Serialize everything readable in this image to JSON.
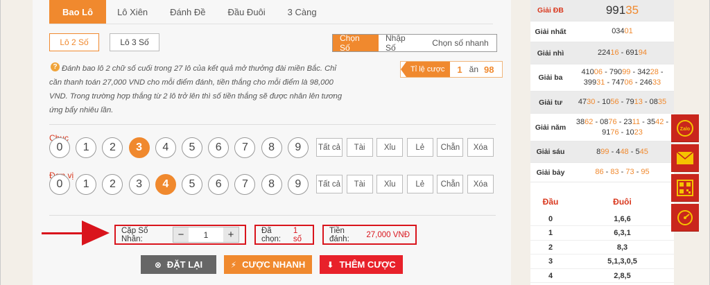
{
  "tabs": [
    "Bao Lô",
    "Lô Xiên",
    "Đánh Đề",
    "Đầu Đuôi",
    "3 Càng"
  ],
  "subtype": [
    "Lô 2 Số",
    "Lô 3 Số"
  ],
  "mode": [
    "Chọn Số",
    "Nhập Số",
    "Chọn số nhanh"
  ],
  "info": "Đánh bao lô 2 chữ số cuối trong 27 lô của kết quả mở thưởng đài miền Bắc. Chỉ cần thanh toán 27,000 VND cho mỗi điểm đánh, tiền thắng cho mỗi điểm là 98,000 VND. Trong trường hợp thắng từ 2 lô trở lên thì số tiền thắng sẽ được nhân lên tương ứng bẩy nhiêu lần.",
  "ratio": {
    "label": "Tỉ lệ cược",
    "bet": "1",
    "an": "ăn",
    "win": "98"
  },
  "rows": [
    {
      "label": "Chục",
      "selected": 3
    },
    {
      "label": "Đơn vị",
      "selected": 4
    }
  ],
  "digits": [
    "0",
    "1",
    "2",
    "3",
    "4",
    "5",
    "6",
    "7",
    "8",
    "9"
  ],
  "quick": [
    "Tất cả",
    "Tài",
    "Xỉu",
    "Lẻ",
    "Chẵn",
    "Xóa"
  ],
  "multiplier": {
    "label": "Cặp Số Nhân:",
    "minus": "−",
    "value": "1",
    "plus": "+"
  },
  "chosen": {
    "label": "Đã chọn:",
    "value": "1 số"
  },
  "amount": {
    "label": "Tiền đánh:",
    "value": "27,000",
    "unit": "VNĐ"
  },
  "actions": [
    {
      "label": "ĐẶT LẠI",
      "icon": "⊗",
      "color": "#666666"
    },
    {
      "label": "CƯỢC NHANH",
      "icon": "⚡",
      "color": "#f0892e"
    },
    {
      "label": "THÊM CƯỢC",
      "icon": "⬇",
      "color": "#e8212a"
    }
  ],
  "results": [
    {
      "name": "Giải ĐB",
      "lines": [
        [
          [
            "991",
            ""
          ],
          [
            "35",
            "hl"
          ]
        ]
      ]
    },
    {
      "name": "Giải nhất",
      "lines": [
        [
          [
            "034",
            ""
          ],
          [
            "01",
            "hl"
          ]
        ]
      ]
    },
    {
      "name": "Giải nhì",
      "lines": [
        [
          [
            "224",
            ""
          ],
          [
            "16",
            "hl"
          ],
          [
            " - 691",
            ""
          ],
          [
            "94",
            "hl"
          ]
        ]
      ]
    },
    {
      "name": "Giải ba",
      "lines": [
        [
          [
            "410",
            ""
          ],
          [
            "06",
            "hl"
          ],
          [
            " - 790",
            ""
          ],
          [
            "99",
            "hl"
          ],
          [
            " - 342",
            ""
          ],
          [
            "28",
            "hl"
          ],
          [
            " -",
            ""
          ]
        ],
        [
          [
            "399",
            ""
          ],
          [
            "31",
            "hl"
          ],
          [
            " - 747",
            ""
          ],
          [
            "06",
            "hl"
          ],
          [
            " - 246",
            ""
          ],
          [
            "33",
            "hl"
          ]
        ]
      ]
    },
    {
      "name": "Giải tư",
      "lines": [
        [
          [
            "47",
            ""
          ],
          [
            "30",
            "hl"
          ],
          [
            " - 10",
            ""
          ],
          [
            "56",
            "hl"
          ],
          [
            " - 79",
            ""
          ],
          [
            "13",
            "hl"
          ],
          [
            " - 08",
            ""
          ],
          [
            "35",
            "hl"
          ]
        ]
      ]
    },
    {
      "name": "Giải năm",
      "lines": [
        [
          [
            "38",
            ""
          ],
          [
            "62",
            "hl"
          ],
          [
            " - 08",
            ""
          ],
          [
            "76",
            "hl"
          ],
          [
            " - 23",
            ""
          ],
          [
            "11",
            "hl"
          ],
          [
            " - 35",
            ""
          ],
          [
            "42",
            "hl"
          ],
          [
            " -",
            ""
          ]
        ],
        [
          [
            "91",
            ""
          ],
          [
            "76",
            "hl"
          ],
          [
            " - 10",
            ""
          ],
          [
            "23",
            "hl"
          ]
        ]
      ]
    },
    {
      "name": "Giải sáu",
      "lines": [
        [
          [
            "8",
            ""
          ],
          [
            "99",
            "hl"
          ],
          [
            " - 4",
            ""
          ],
          [
            "48",
            "hl"
          ],
          [
            " - 5",
            ""
          ],
          [
            "45",
            "hl"
          ]
        ]
      ]
    },
    {
      "name": "Giải bảy",
      "lines": [
        [
          [
            "86",
            "hl"
          ],
          [
            " - ",
            ""
          ],
          [
            "83",
            "hl"
          ],
          [
            " - ",
            ""
          ],
          [
            "73",
            "hl"
          ],
          [
            " - ",
            ""
          ],
          [
            "95",
            "hl"
          ]
        ]
      ]
    }
  ],
  "loto": {
    "head": [
      "Đầu",
      "Đuôi"
    ],
    "rows": [
      [
        "0",
        "1,6,6"
      ],
      [
        "1",
        "6,3,1"
      ],
      [
        "2",
        "8,3"
      ],
      [
        "3",
        "5,1,3,0,5"
      ],
      [
        "4",
        "2,8,5"
      ]
    ]
  },
  "side": [
    "zalo-icon",
    "mail-icon",
    "qr-icon",
    "speed-icon"
  ]
}
